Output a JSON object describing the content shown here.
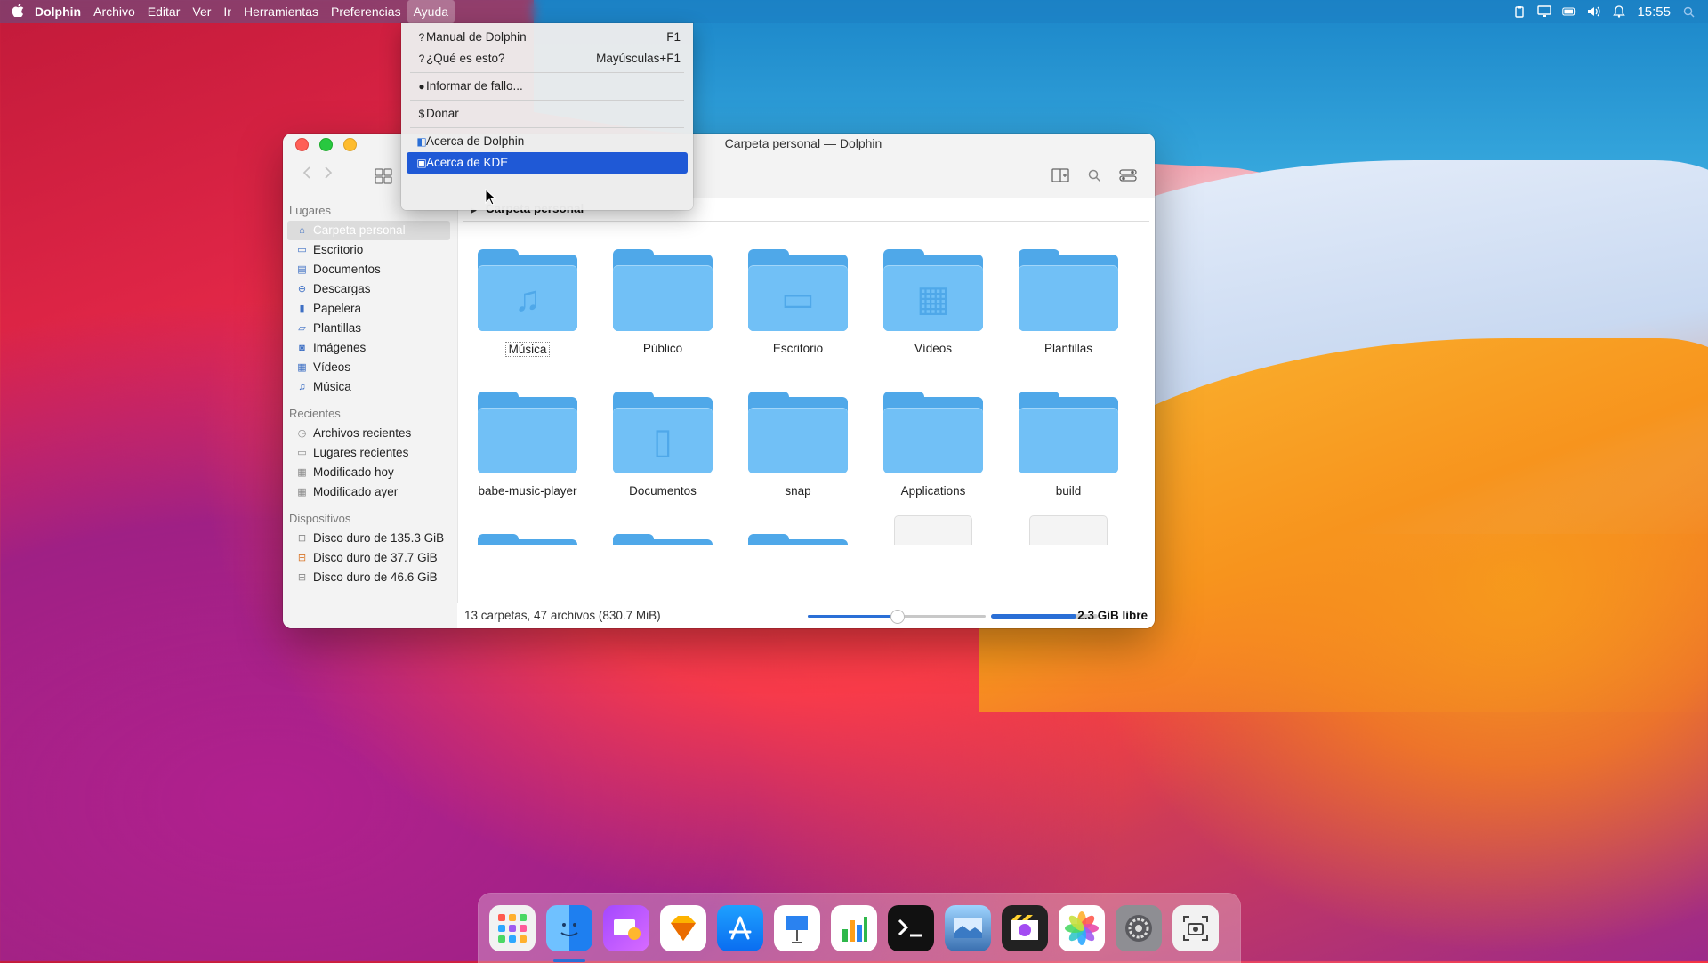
{
  "menubar": {
    "app_name": "Dolphin",
    "items": [
      "Archivo",
      "Editar",
      "Ver",
      "Ir",
      "Herramientas",
      "Preferencias",
      "Ayuda"
    ],
    "clock": "15:55"
  },
  "help_menu": {
    "items": [
      {
        "icon": "help-icon",
        "label": "Manual de Dolphin",
        "shortcut": "F1"
      },
      {
        "icon": "help-icon",
        "label": "¿Qué es esto?",
        "shortcut": "Mayúsculas+F1"
      },
      {
        "icon": "bug-icon",
        "label": "Informar de fallo...",
        "shortcut": ""
      },
      {
        "icon": "dollar-icon",
        "label": "Donar",
        "shortcut": ""
      },
      {
        "icon": "dolphin-icon",
        "label": "Acerca de Dolphin",
        "shortcut": ""
      },
      {
        "icon": "kde-icon",
        "label": "Acerca de KDE",
        "shortcut": ""
      }
    ]
  },
  "window": {
    "title": "Carpeta personal — Dolphin",
    "breadcrumb": "Carpeta personal"
  },
  "sidebar": {
    "places_header": "Lugares",
    "places": [
      "Carpeta personal",
      "Escritorio",
      "Documentos",
      "Descargas",
      "Papelera",
      "Plantillas",
      "Imágenes",
      "Vídeos",
      "Música"
    ],
    "recent_header": "Recientes",
    "recent": [
      "Archivos recientes",
      "Lugares recientes",
      "Modificado hoy",
      "Modificado ayer"
    ],
    "devices_header": "Dispositivos",
    "devices": [
      "Disco duro de 135.3 GiB",
      "Disco duro de 37.7 GiB",
      "Disco duro de 46.6 GiB"
    ]
  },
  "files": [
    {
      "name": "Música",
      "glyph": "♫"
    },
    {
      "name": "Público",
      "glyph": ""
    },
    {
      "name": "Escritorio",
      "glyph": "▭"
    },
    {
      "name": "Vídeos",
      "glyph": "▦"
    },
    {
      "name": "Plantillas",
      "glyph": ""
    },
    {
      "name": "babe-music-player",
      "glyph": ""
    },
    {
      "name": "Documentos",
      "glyph": "▯"
    },
    {
      "name": "snap",
      "glyph": ""
    },
    {
      "name": "Applications",
      "glyph": ""
    },
    {
      "name": "build",
      "glyph": ""
    }
  ],
  "status": {
    "summary": "13 carpetas, 47 archivos (830.7 MiB)",
    "free": "2.3 GiB libre",
    "zoom_level": 0.5,
    "used_fraction": 0.8
  },
  "dock": {
    "apps": [
      "launchpad-icon",
      "finder-icon",
      "mail-icon",
      "sketch-icon",
      "app-store-icon",
      "keynote-icon",
      "numbers-icon",
      "terminal-icon",
      "preview-icon",
      "final-cut-icon",
      "photos-icon",
      "system-preferences-icon",
      "screenshot-icon"
    ]
  }
}
